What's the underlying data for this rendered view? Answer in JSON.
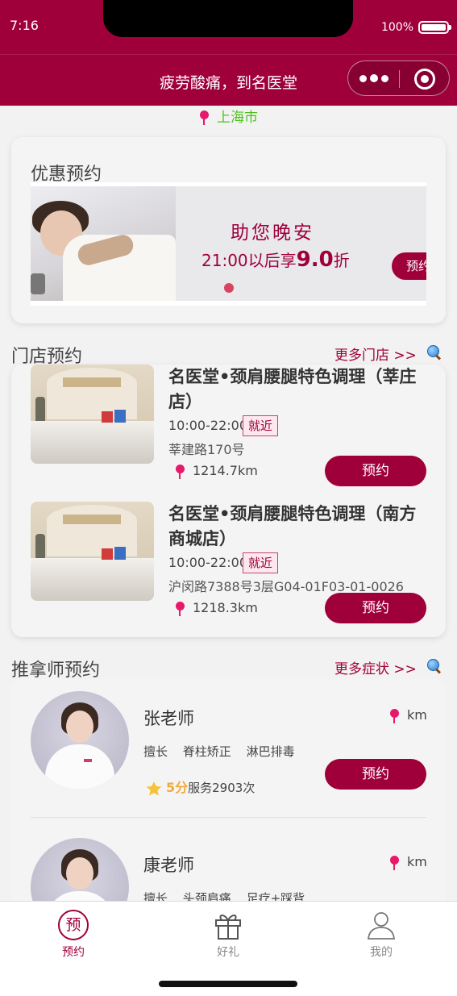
{
  "status_bar": {
    "time": "7:16",
    "battery": "100%"
  },
  "nav": {
    "title": "疲劳酸痛，到名医堂"
  },
  "location": {
    "city": "上海市"
  },
  "promo": {
    "heading": "优惠预约",
    "banner_line1": "助您晚安",
    "banner_line2_prefix": "21:00以后享",
    "banner_line2_value": "9.0",
    "banner_line2_suffix": "折",
    "banner_button": "预约"
  },
  "stores_section": {
    "title": "门店预约",
    "more": "更多门店 >>",
    "items": [
      {
        "name": "名医堂•颈肩腰腿特色调理（莘庄店）",
        "hours": "10:00-22:00",
        "tag": "就近",
        "address": "莘建路170号",
        "distance": "1214.7km",
        "button": "预约"
      },
      {
        "name": "名医堂•颈肩腰腿特色调理（南方商城店）",
        "hours": "10:00-22:00",
        "tag": "就近",
        "address": "沪闵路7388号3层G04-01F03-01-0026",
        "distance": "1218.3km",
        "button": "预约"
      }
    ]
  },
  "therapists_section": {
    "title": "推拿师预约",
    "more": "更多症状 >>",
    "items": [
      {
        "name": "张老师",
        "distance": "km",
        "skills_label": "擅长",
        "skills": [
          "脊柱矫正",
          "淋巴排毒"
        ],
        "score": "5分",
        "service": "服务2903次",
        "button": "预约"
      },
      {
        "name": "康老师",
        "distance": "km",
        "skills_label": "擅长",
        "skills": [
          "头颈肩痛",
          "足疗+踩背"
        ]
      }
    ]
  },
  "tabbar": {
    "tabs": [
      {
        "label": "预约",
        "icon": "预",
        "active": true
      },
      {
        "label": "好礼",
        "active": false
      },
      {
        "label": "我的",
        "active": false
      }
    ]
  },
  "colors": {
    "brand": "#a0003a",
    "location_green": "#4cc21d",
    "star": "#f0a93a"
  }
}
